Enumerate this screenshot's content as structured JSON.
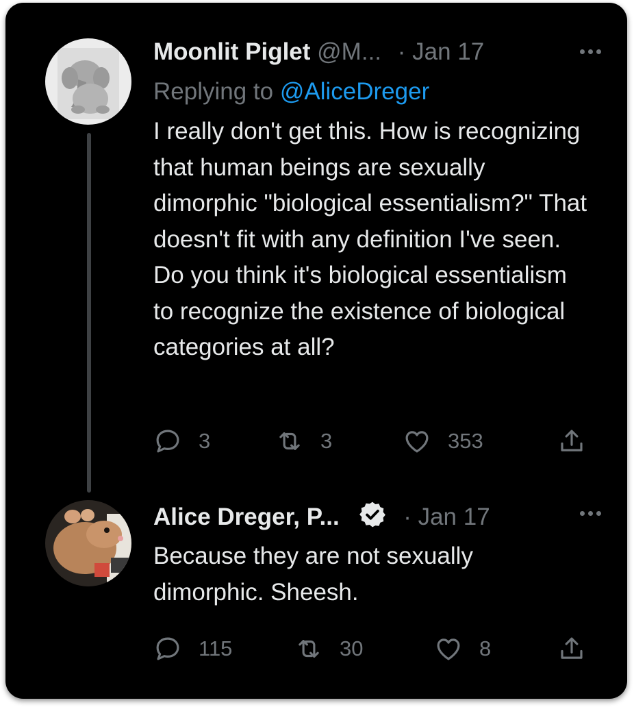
{
  "tweets": [
    {
      "display_name": "Moonlit Piglet",
      "handle": "@M...",
      "separator": "·",
      "date": "Jan 17",
      "replying_prefix": "Replying to",
      "replying_to": "@AliceDreger",
      "text": "I really don't get this. How is recognizing that human beings are sexually dimorphic \"biological essentialism?\" That doesn't fit with any definition I've seen. Do you think it's biological essentialism to recognize the existence of biological categories at all?",
      "replies": "3",
      "retweets": "3",
      "likes": "353"
    },
    {
      "display_name": "Alice Dreger, P...",
      "verified": true,
      "separator": "·",
      "date": "Jan 17",
      "text": "Because they are not sexually dimorphic. Sheesh.",
      "replies": "115",
      "retweets": "30",
      "likes": "8"
    }
  ],
  "colors": {
    "background": "#000000",
    "text": "#e7e9ea",
    "muted": "#71767b",
    "link": "#1d9bf0",
    "thread_line": "#3e4144"
  },
  "icons": [
    "more-icon",
    "reply-icon",
    "retweet-icon",
    "like-icon",
    "share-icon",
    "verified-badge-icon"
  ]
}
